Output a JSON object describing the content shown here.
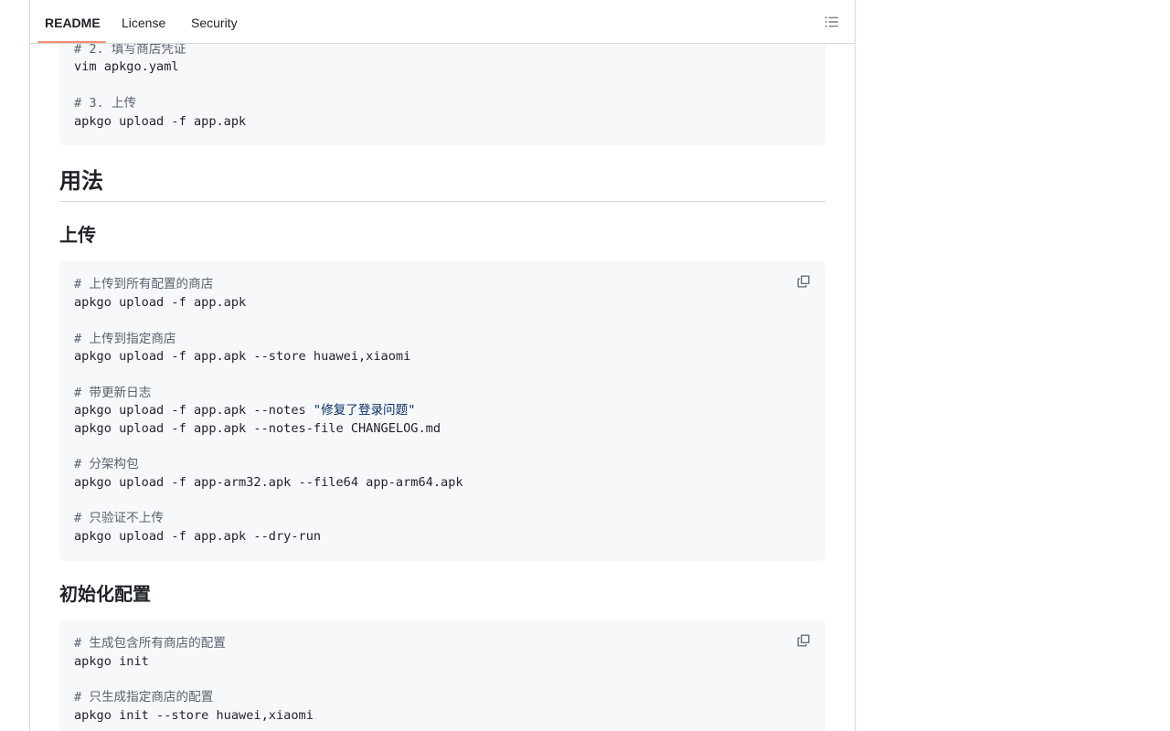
{
  "tabs": {
    "readme": "README",
    "license": "License",
    "security": "Security"
  },
  "icons": {
    "outline": "list-unordered-icon",
    "copy": "copy-icon"
  },
  "block_top": {
    "lines": [
      "# 2. 填写商店凭证",
      "vim apkgo.yaml",
      "",
      "# 3. 上传",
      "apkgo upload -f app.apk"
    ]
  },
  "headings": {
    "usage": "用法",
    "upload": "上传",
    "init": "初始化配置"
  },
  "block_upload": {
    "l1": "# 上传到所有配置的商店",
    "l2": "apkgo upload -f app.apk",
    "l3": "# 上传到指定商店",
    "l4": "apkgo upload -f app.apk --store huawei,xiaomi",
    "l5": "# 带更新日志",
    "l6_prefix": "apkgo upload -f app.apk --notes ",
    "l6_string": "\"修复了登录问题\"",
    "l7": "apkgo upload -f app.apk --notes-file CHANGELOG.md",
    "l8": "# 分架构包",
    "l9": "apkgo upload -f app-arm32.apk --file64 app-arm64.apk",
    "l10": "# 只验证不上传",
    "l11": "apkgo upload -f app.apk --dry-run"
  },
  "block_init": {
    "l1": "# 生成包含所有商店的配置",
    "l2": "apkgo init",
    "l3": "# 只生成指定商店的配置",
    "l4": "apkgo init --store huawei,xiaomi"
  },
  "colors": {
    "accent_underline": "#fd8c73",
    "code_bg": "#f6f8fa",
    "comment": "#59636e",
    "string": "#0a3069",
    "border": "#d1d9e0"
  }
}
